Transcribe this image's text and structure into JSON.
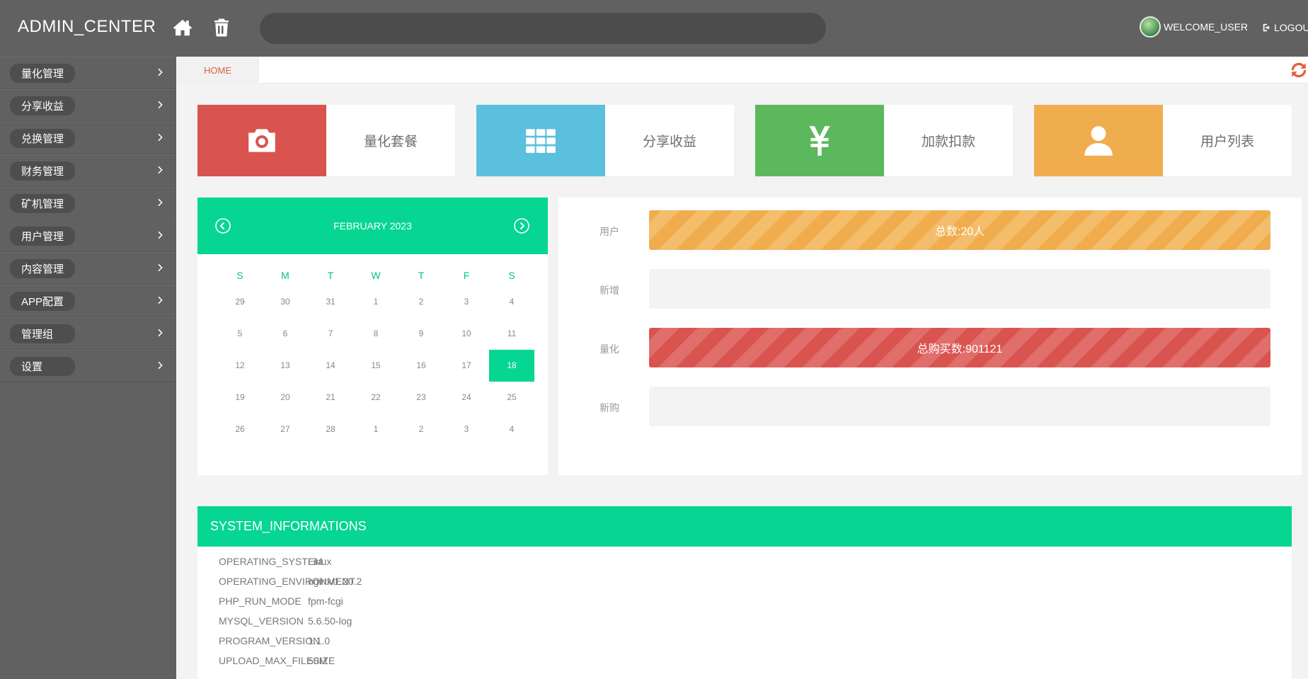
{
  "header": {
    "brand": "ADMIN_CENTER",
    "search_value": "",
    "welcome": "WELCOME_USER",
    "logout": "LOGOUT"
  },
  "icons": {
    "home": "home-icon",
    "trash": "trash-icon",
    "logout": "logout-icon",
    "refresh": "refresh-icon",
    "chevron": "chevron-right-icon"
  },
  "sidebar": {
    "items": [
      {
        "label": "量化管理"
      },
      {
        "label": "分享收益"
      },
      {
        "label": "兑换管理"
      },
      {
        "label": "财务管理"
      },
      {
        "label": "矿机管理"
      },
      {
        "label": "用户管理"
      },
      {
        "label": "内容管理"
      },
      {
        "label": "APP配置"
      },
      {
        "label": "管理组"
      },
      {
        "label": "设置"
      }
    ]
  },
  "breadcrumb": {
    "home": "HOME"
  },
  "tiles": [
    {
      "label": "量化套餐",
      "color": "#d9534f",
      "icon": "camera-icon"
    },
    {
      "label": "分享收益",
      "color": "#5bc0de",
      "icon": "grid-icon"
    },
    {
      "label": "加款扣款",
      "color": "#5cb85c",
      "icon": "yen-icon"
    },
    {
      "label": "用户列表",
      "color": "#f0ad4e",
      "icon": "user-icon"
    }
  ],
  "calendar": {
    "month": "FEBRUARY 2023",
    "weekdays": [
      "S",
      "M",
      "T",
      "W",
      "T",
      "F",
      "S"
    ],
    "weeks": [
      [
        "29",
        "30",
        "31",
        "1",
        "2",
        "3",
        "4"
      ],
      [
        "5",
        "6",
        "7",
        "8",
        "9",
        "10",
        "11"
      ],
      [
        "12",
        "13",
        "14",
        "15",
        "16",
        "17",
        "18"
      ],
      [
        "19",
        "20",
        "21",
        "22",
        "23",
        "24",
        "25"
      ],
      [
        "26",
        "27",
        "28",
        "1",
        "2",
        "3",
        "4"
      ]
    ],
    "today": "18",
    "accent": "#06d692"
  },
  "stats": [
    {
      "label": "用户",
      "text": "总数:20人",
      "fill": 1.0,
      "style": "orange"
    },
    {
      "label": "新增",
      "text": "",
      "fill": 0.0,
      "style": "orange"
    },
    {
      "label": "量化",
      "text": "总购买数:901121",
      "fill": 1.0,
      "style": "red"
    },
    {
      "label": "新购",
      "text": "",
      "fill": 0.0,
      "style": "red"
    }
  ],
  "system": {
    "title": "SYSTEM_INFORMATIONS",
    "rows": [
      {
        "key": "OPERATING_SYSTEM",
        "value": "Linux"
      },
      {
        "key": "OPERATING_ENVIRONMENT",
        "value": "nginx/1.20.2"
      },
      {
        "key": "PHP_RUN_MODE",
        "value": "fpm-fcgi"
      },
      {
        "key": "MYSQL_VERSION",
        "value": "5.6.50-log"
      },
      {
        "key": "PROGRAM_VERSION",
        "value": "1.1.0"
      },
      {
        "key": "UPLOAD_MAX_FILESIZE",
        "value": "50M"
      }
    ]
  }
}
